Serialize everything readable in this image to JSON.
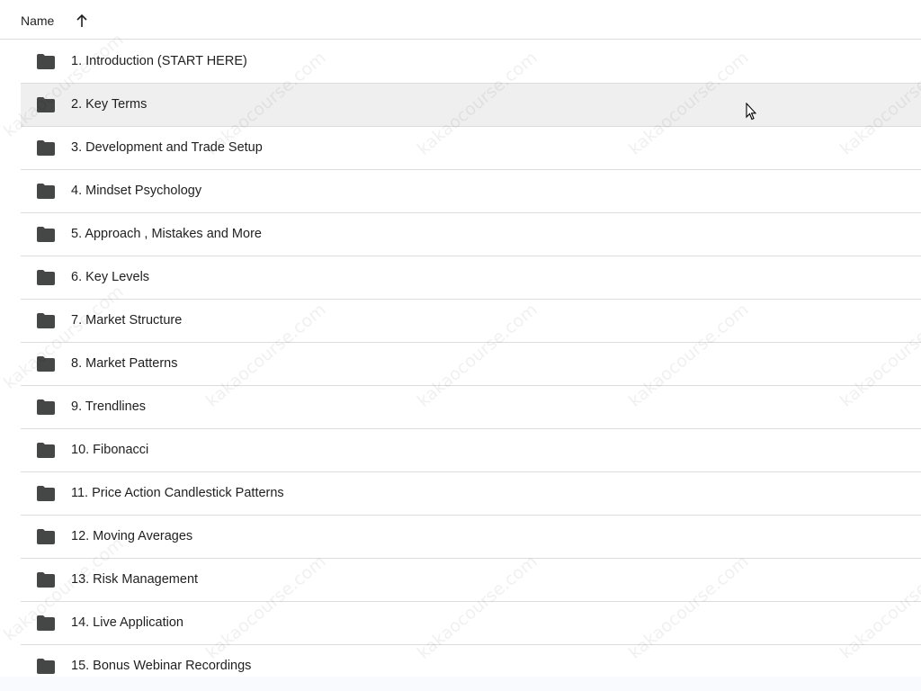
{
  "header": {
    "name_label": "Name",
    "sort_icon": "arrow-up-icon"
  },
  "folders": [
    {
      "label": "1. Introduction (START HERE)"
    },
    {
      "label": "2. Key Terms"
    },
    {
      "label": "3. Development and Trade Setup"
    },
    {
      "label": "4. Mindset Psychology"
    },
    {
      "label": "5. Approach , Mistakes and More"
    },
    {
      "label": "6. Key Levels"
    },
    {
      "label": "7. Market Structure"
    },
    {
      "label": "8. Market Patterns"
    },
    {
      "label": "9. Trendlines"
    },
    {
      "label": "10. Fibonacci"
    },
    {
      "label": "11. Price Action Candlestick Patterns"
    },
    {
      "label": "12. Moving Averages"
    },
    {
      "label": "13. Risk Management"
    },
    {
      "label": "14. Live Application"
    },
    {
      "label": "15. Bonus Webinar Recordings"
    }
  ],
  "hovered_row": "2. Key Terms",
  "watermark_text": "kakaocourse.com",
  "colors": {
    "folder": "#444746",
    "hover": "#efefef",
    "divider": "#dadce0"
  }
}
